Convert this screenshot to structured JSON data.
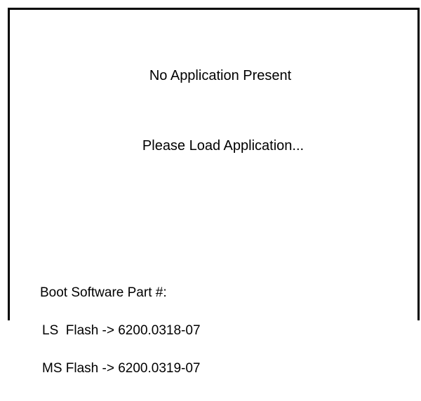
{
  "status": {
    "primary_message": "No Application Present",
    "secondary_message": "Please Load Application..."
  },
  "boot_info": {
    "heading": "Boot Software Part #:",
    "entries": [
      {
        "text": "LS  Flash -> 6200.0318-07"
      },
      {
        "text": "MS Flash -> 6200.0319-07"
      }
    ]
  },
  "colors": {
    "background": "#ffffff",
    "text": "#000000",
    "frame": "#000000"
  }
}
